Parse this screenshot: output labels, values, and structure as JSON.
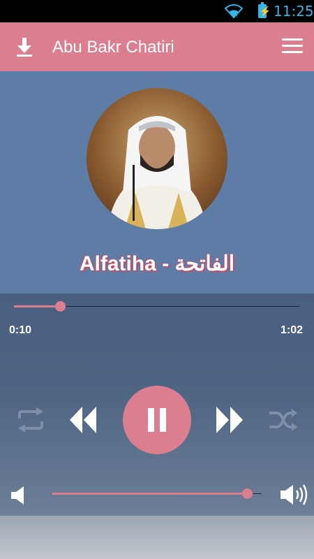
{
  "status_bar": {
    "time": "11:25",
    "icons": [
      "wifi-icon",
      "battery-charging-icon"
    ],
    "color": "#33b5e5"
  },
  "app_bar": {
    "title": "Abu Bakr Chatiri",
    "download_icon": "download-icon",
    "menu_icon": "menu-icon",
    "color": "#db7f90"
  },
  "now_playing": {
    "title": "Alfatiha - الفاتحة",
    "avatar_icon": "reciter-avatar"
  },
  "player": {
    "current_time": "0:10",
    "duration": "1:02",
    "progress_fraction": 0.16,
    "volume_fraction": 0.93,
    "controls": [
      "repeat-icon",
      "rewind-icon",
      "pause-icon",
      "fast-forward-icon",
      "shuffle-icon"
    ],
    "accent_color": "#db7f90"
  }
}
